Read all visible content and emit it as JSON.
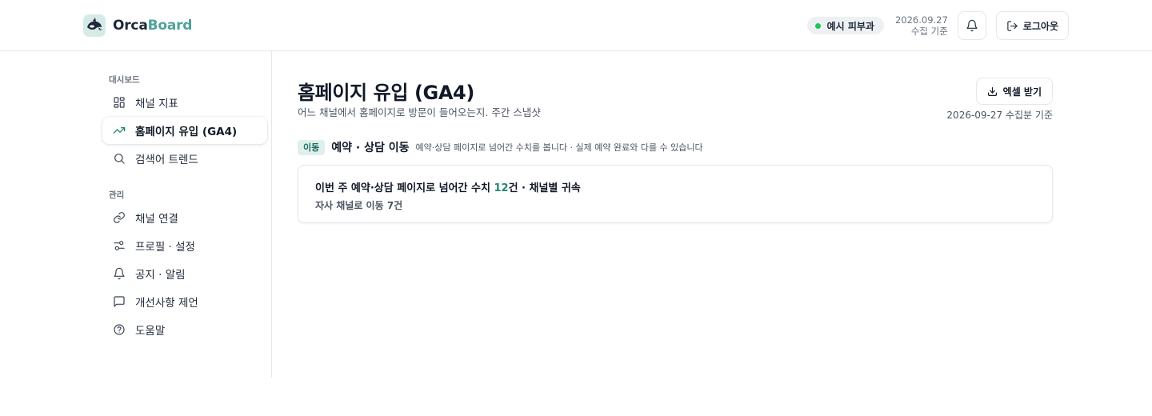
{
  "brand": {
    "name_part1": "Orca",
    "name_part2": "Board"
  },
  "header": {
    "org_name": "예시 피부과",
    "collect_date": "2026.09.27",
    "collect_label": "수집 기준",
    "logout_label": "로그아웃",
    "status_color": "#22c55e"
  },
  "sidebar": {
    "section_dashboard": "대시보드",
    "section_manage": "관리",
    "items": [
      {
        "label": "채널 지표",
        "icon": "grid-icon"
      },
      {
        "label": "홈페이지 유입 (GA4)",
        "icon": "trending-up-icon",
        "active": true
      },
      {
        "label": "검색어 트렌드",
        "icon": "search-icon"
      },
      {
        "label": "채널 연결",
        "icon": "link-icon"
      },
      {
        "label": "프로필 · 설정",
        "icon": "sliders-icon"
      },
      {
        "label": "공지 · 알림",
        "icon": "bell-icon"
      },
      {
        "label": "개선사항 제언",
        "icon": "message-icon"
      },
      {
        "label": "도움말",
        "icon": "help-icon"
      }
    ]
  },
  "main": {
    "title": "홈페이지 유입 (GA4)",
    "subtitle": "어느 채널에서 홈페이지로 방문이 들어오는지. 주간 스냅샷",
    "excel_label": "엑셀 받기",
    "basis": "2026-09-27 수집분 기준",
    "section": {
      "tag": "이동",
      "title": "예약 · 상담 이동",
      "note": "예약·상담 페이지로 넘어간 수치를 봅니다 · 실제 예약 완료와 다를 수 있습니다"
    },
    "card": {
      "line1_prefix": "이번 주 예약·상담 페이지로 넘어간 수치 ",
      "line1_count": "12",
      "line1_suffix": "건 · 채널별 귀속",
      "line2": "자사 채널로 이동 7건"
    }
  },
  "colors": {
    "accent": "#4fa29a",
    "positive": "#1f8a6d",
    "tag_bg": "#dff0ec"
  }
}
